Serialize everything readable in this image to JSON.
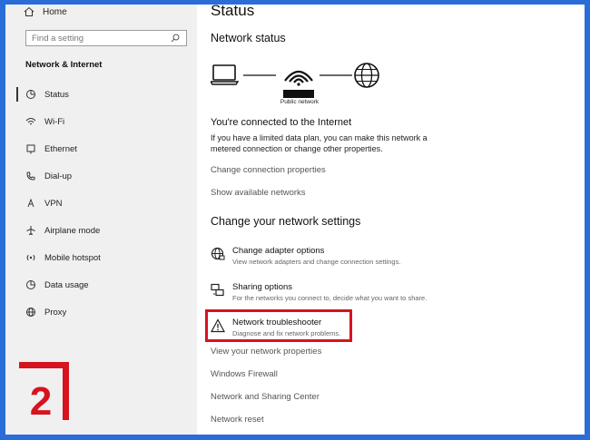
{
  "sidebar": {
    "home_label": "Home",
    "search_placeholder": "Find a setting",
    "section_title": "Network & Internet",
    "items": [
      {
        "label": "Status",
        "icon": "status-icon"
      },
      {
        "label": "Wi-Fi",
        "icon": "wifi-icon"
      },
      {
        "label": "Ethernet",
        "icon": "ethernet-icon"
      },
      {
        "label": "Dial-up",
        "icon": "dialup-icon"
      },
      {
        "label": "VPN",
        "icon": "vpn-icon"
      },
      {
        "label": "Airplane mode",
        "icon": "airplane-icon"
      },
      {
        "label": "Mobile hotspot",
        "icon": "hotspot-icon"
      },
      {
        "label": "Data usage",
        "icon": "data-usage-icon"
      },
      {
        "label": "Proxy",
        "icon": "globe-icon"
      }
    ],
    "active_item": "Status"
  },
  "badge": {
    "number": "2",
    "color": "#d7131f"
  },
  "main": {
    "title": "Status",
    "network_status_heading": "Network status",
    "network_label": "Public network",
    "connected_heading": "You're connected to the Internet",
    "connected_desc": "If you have a limited data plan, you can make this network a metered connection or change other properties.",
    "links_top": [
      "Change connection properties",
      "Show available networks"
    ],
    "change_heading": "Change your network settings",
    "options": [
      {
        "title": "Change adapter options",
        "desc": "View network adapters and change connection settings.",
        "icon": "adapter-globe-icon"
      },
      {
        "title": "Sharing options",
        "desc": "For the networks you connect to, decide what you want to share.",
        "icon": "sharing-icon"
      },
      {
        "title": "Network troubleshooter",
        "desc": "Diagnose and fix network problems.",
        "icon": "warning-icon",
        "highlighted": true
      }
    ],
    "links_bottom": [
      "View your network properties",
      "Windows Firewall",
      "Network and Sharing Center",
      "Network reset"
    ]
  },
  "colors": {
    "highlight": "#d7131f",
    "frame": "#2a6dd9",
    "sidebar_bg": "#f0f0f0"
  }
}
